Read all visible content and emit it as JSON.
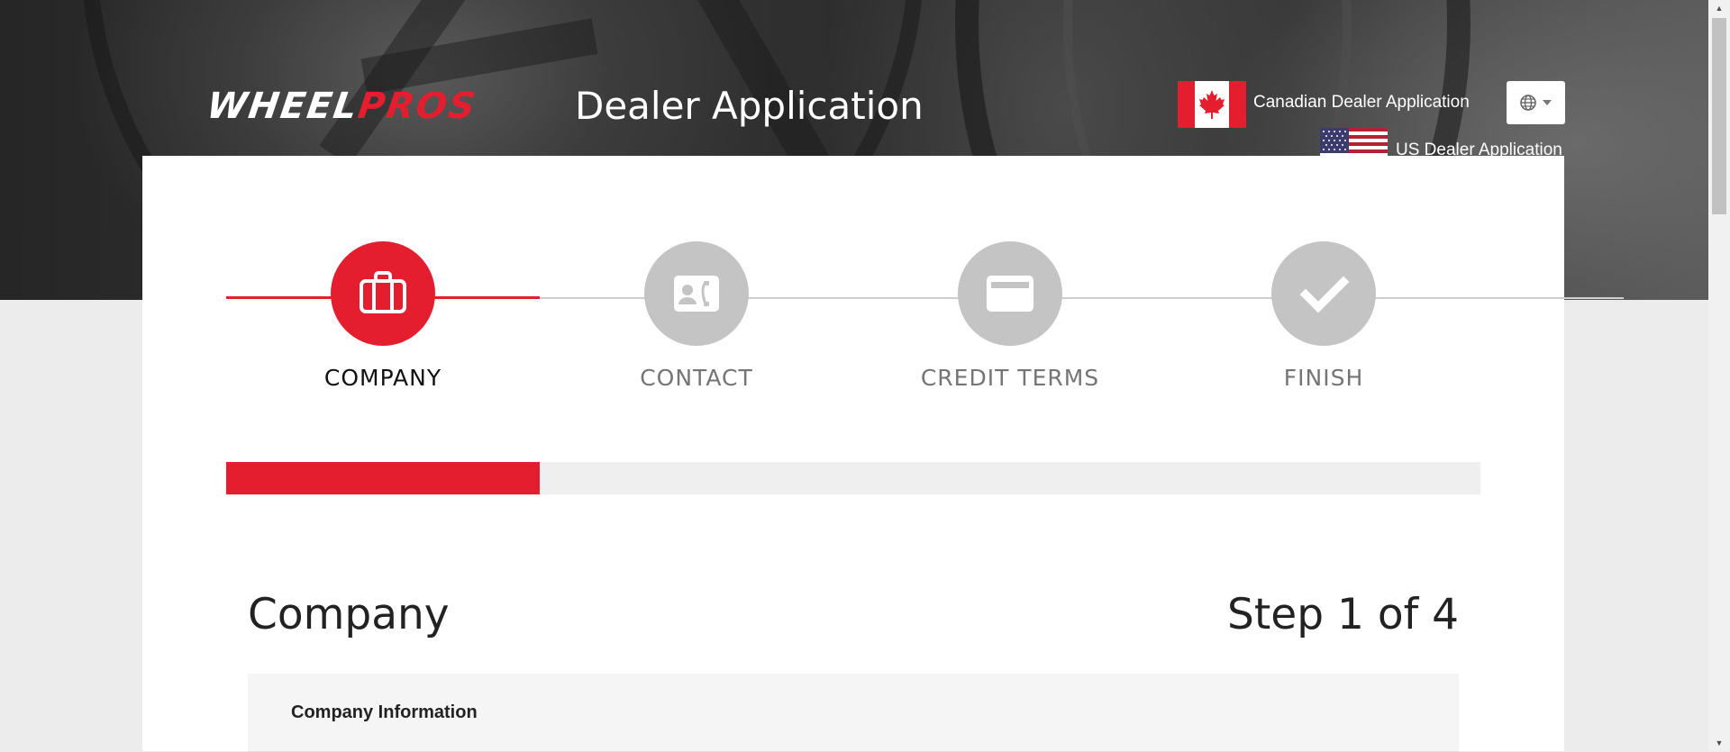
{
  "header": {
    "logo_part1": "WHEEL",
    "logo_part2": "PROS",
    "title": "Dealer Application",
    "canadian_link": "Canadian Dealer Application",
    "us_link": "US Dealer Application",
    "language_selector_icon": "globe-icon"
  },
  "wizard": {
    "steps": [
      {
        "label": "COMPANY",
        "icon": "briefcase-icon",
        "state": "active"
      },
      {
        "label": "CONTACT",
        "icon": "contact-card-icon",
        "state": "inactive"
      },
      {
        "label": "CREDIT TERMS",
        "icon": "credit-card-icon",
        "state": "inactive"
      },
      {
        "label": "FINISH",
        "icon": "checkmark-icon",
        "state": "inactive"
      }
    ],
    "progress_fraction": 0.25
  },
  "main": {
    "section_title": "Company",
    "step_counter": "Step 1 of 4",
    "panel_heading": "Company Information"
  },
  "colors": {
    "accent": "#e41e2f",
    "inactive_step": "#c4c4c4",
    "inactive_label": "#757575"
  }
}
